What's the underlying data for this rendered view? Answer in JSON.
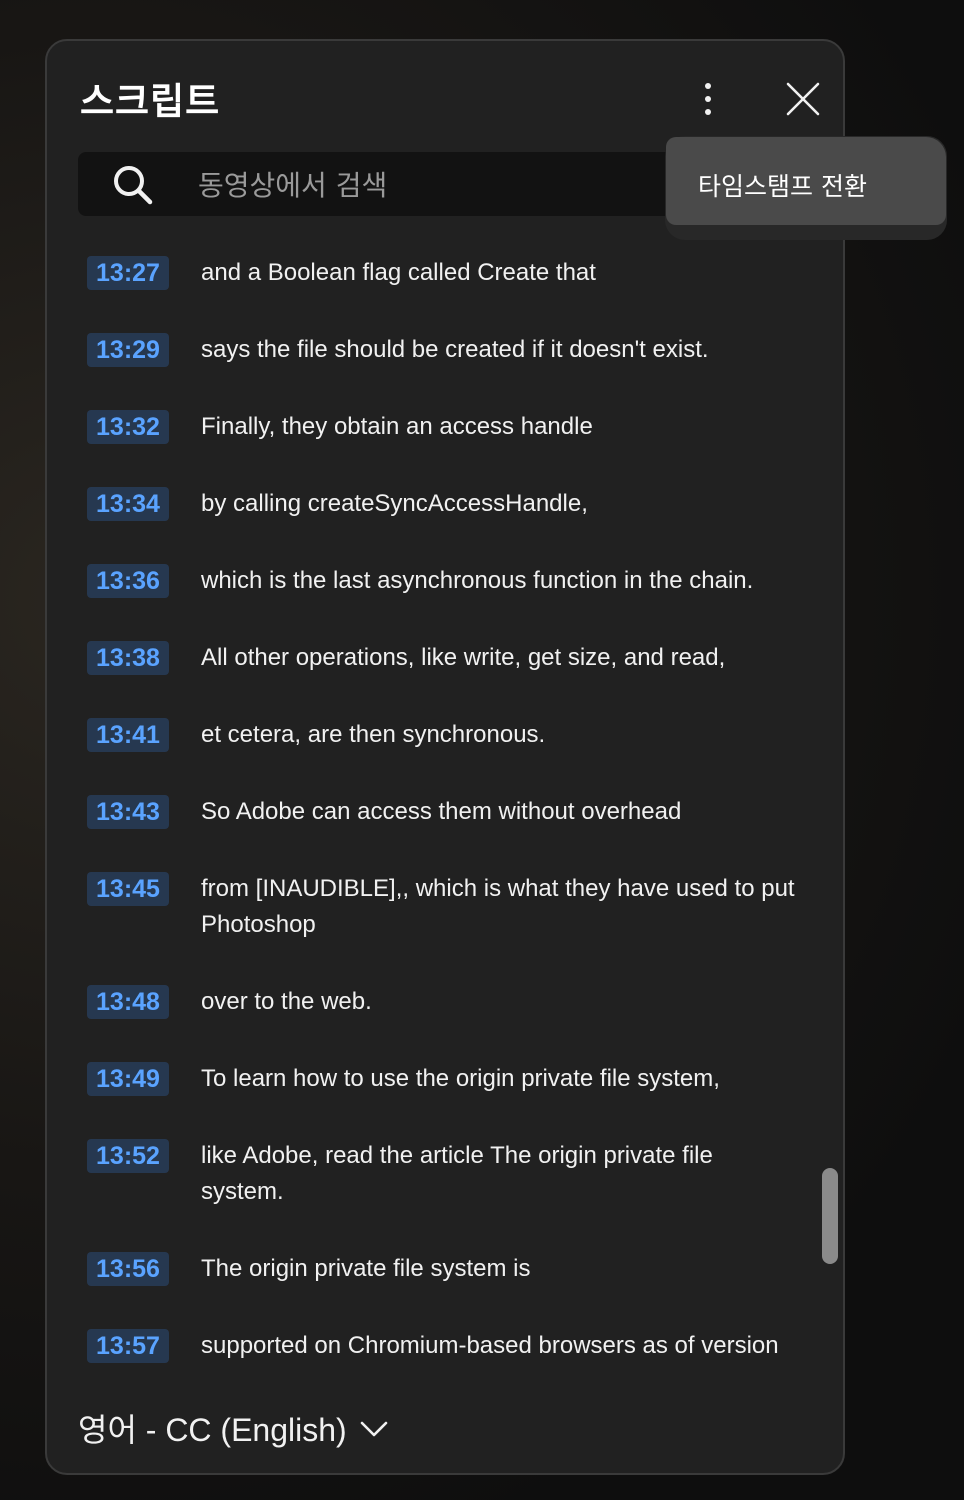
{
  "panel": {
    "title": "스크립트",
    "more_icon": "vertical-dots-icon",
    "close_icon": "close-x-icon"
  },
  "search": {
    "placeholder": "동영상에서 검색",
    "value": "",
    "icon": "search-icon"
  },
  "menu": {
    "items": [
      {
        "label": "타임스탬프 전환"
      }
    ]
  },
  "transcript": [
    {
      "time": "13:27",
      "text": "and a Boolean flag called Create that"
    },
    {
      "time": "13:29",
      "text": "says the file should be created if it doesn't exist."
    },
    {
      "time": "13:32",
      "text": "Finally, they obtain an access handle"
    },
    {
      "time": "13:34",
      "text": "by calling createSyncAccessHandle,"
    },
    {
      "time": "13:36",
      "text": "which is the last asynchronous function in the chain."
    },
    {
      "time": "13:38",
      "text": "All other operations, like write, get size, and read,"
    },
    {
      "time": "13:41",
      "text": "et cetera, are then synchronous."
    },
    {
      "time": "13:43",
      "text": "So Adobe can access them without overhead"
    },
    {
      "time": "13:45",
      "text": "from [INAUDIBLE],, which is what they have used to put Photoshop"
    },
    {
      "time": "13:48",
      "text": "over to the web."
    },
    {
      "time": "13:49",
      "text": "To learn how to use the origin private file system,"
    },
    {
      "time": "13:52",
      "text": "like Adobe, read the article The origin private file system."
    },
    {
      "time": "13:56",
      "text": "The origin private file system is"
    },
    {
      "time": "13:57",
      "text": "supported on Chromium-based browsers as of version"
    }
  ],
  "footer": {
    "language": "영어 - CC (English)",
    "chevron_icon": "chevron-down-icon"
  },
  "colors": {
    "panel_bg": "#212121",
    "timestamp_bg": "#263850",
    "timestamp_text": "#5aa3ff",
    "menu_bg": "#4a4a4a"
  }
}
